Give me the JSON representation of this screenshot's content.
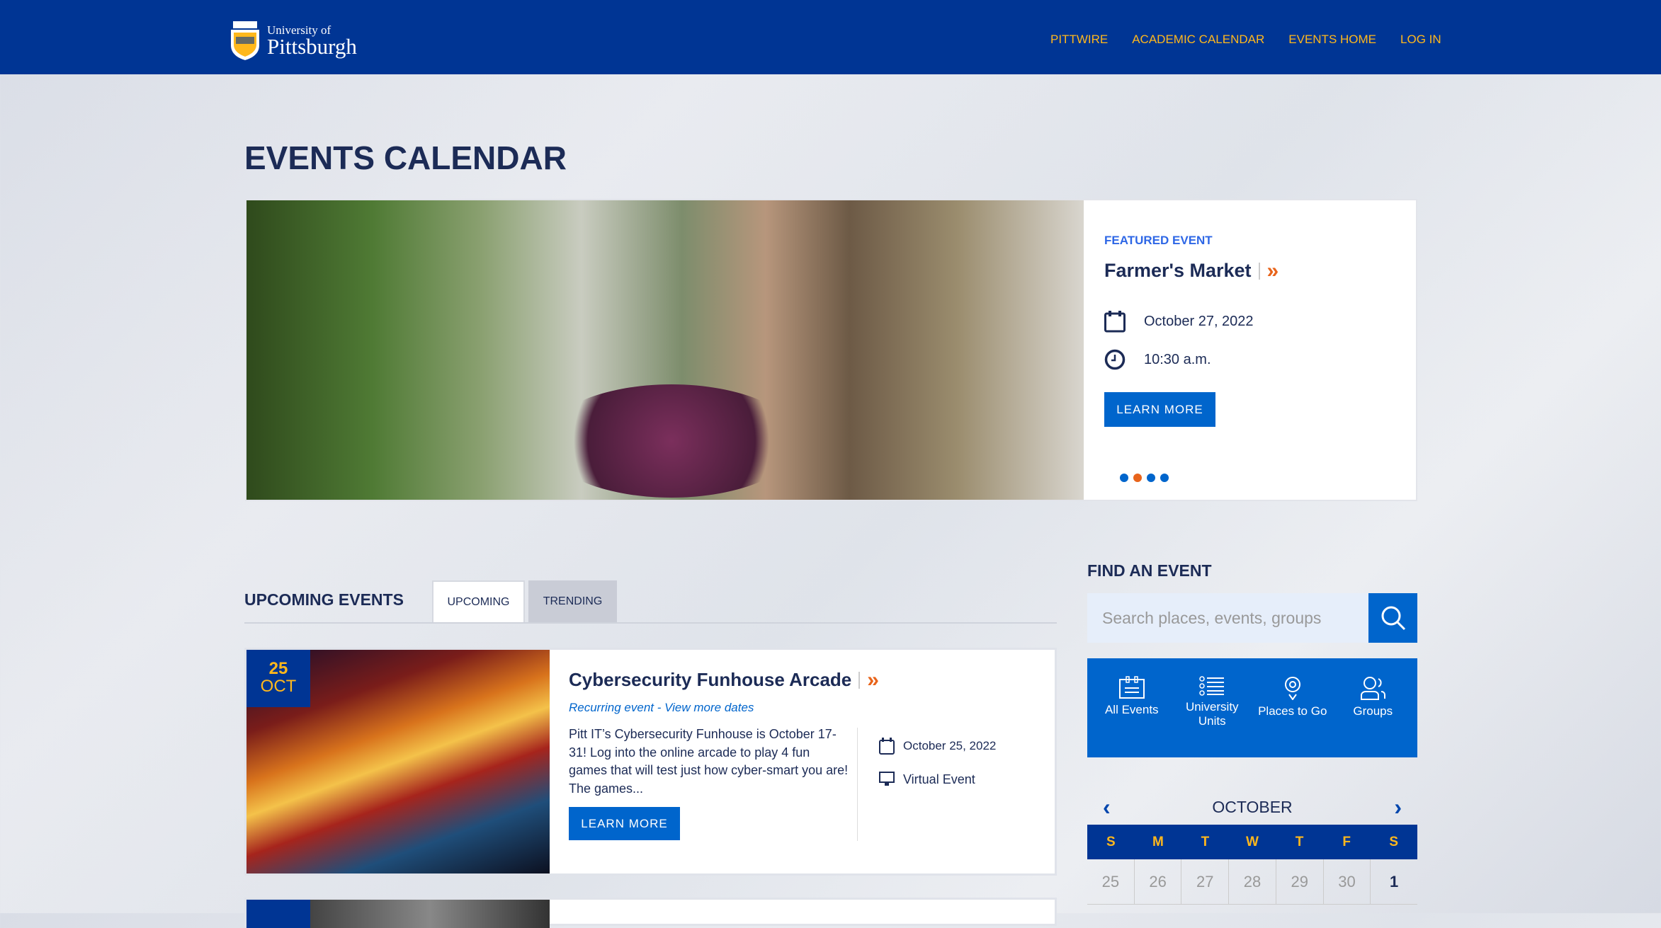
{
  "header": {
    "logo_line1": "University of",
    "logo_line2": "Pittsburgh",
    "nav": [
      "PITTWIRE",
      "ACADEMIC CALENDAR",
      "EVENTS HOME",
      "LOG IN"
    ]
  },
  "page_title": "EVENTS CALENDAR",
  "featured": {
    "label": "FEATURED EVENT",
    "title": "Farmer's Market",
    "date": "October 27, 2022",
    "time": "10:30 a.m.",
    "button": "LEARN MORE",
    "slides": 4,
    "active_slide": 2
  },
  "upcoming": {
    "heading": "UPCOMING EVENTS",
    "tabs": [
      "UPCOMING",
      "TRENDING"
    ],
    "active_tab": "UPCOMING",
    "events": [
      {
        "day": "25",
        "month": "OCT",
        "title": "Cybersecurity Funhouse Arcade",
        "recurring": "Recurring event - View more dates",
        "description": "Pitt IT’s Cybersecurity Funhouse is October 17-31! Log into the online arcade to play 4 fun games that will test just how cyber-smart you are! The games...",
        "date": "October 25, 2022",
        "location": "Virtual Event",
        "button": "LEARN MORE"
      }
    ]
  },
  "find": {
    "heading": "FIND AN EVENT",
    "search_placeholder": "Search places, events, groups",
    "categories": [
      {
        "label": "All Events",
        "icon": "calendar-list-icon"
      },
      {
        "label": "University Units",
        "icon": "list-icon"
      },
      {
        "label": "Places to Go",
        "icon": "map-pin-icon"
      },
      {
        "label": "Groups",
        "icon": "users-icon"
      }
    ]
  },
  "calendar": {
    "month": "OCTOBER",
    "weekdays": [
      "S",
      "M",
      "T",
      "W",
      "T",
      "F",
      "S"
    ],
    "first_row": [
      "25",
      "26",
      "27",
      "28",
      "29",
      "30",
      "1"
    ]
  },
  "colors": {
    "brand_blue": "#003594",
    "accent_blue": "#0065cc",
    "gold": "#ffb81c",
    "orange": "#e8641b"
  }
}
